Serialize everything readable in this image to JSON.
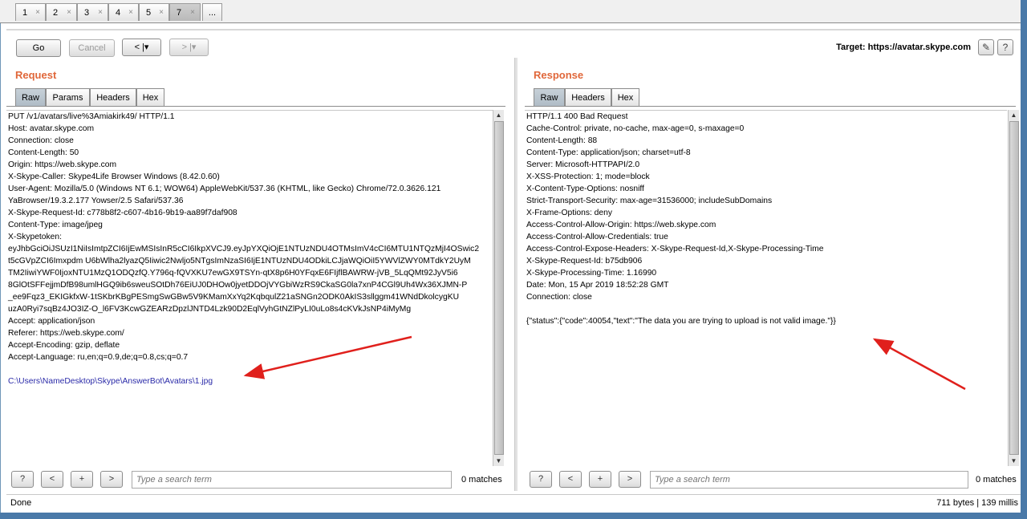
{
  "tabs": [
    {
      "label": "1",
      "close": "×"
    },
    {
      "label": "2",
      "close": "×"
    },
    {
      "label": "3",
      "close": "×"
    },
    {
      "label": "4",
      "close": "×"
    },
    {
      "label": "5",
      "close": "×"
    },
    {
      "label": "7",
      "close": "×"
    },
    {
      "label": "..."
    }
  ],
  "toolbar": {
    "go": "Go",
    "cancel": "Cancel",
    "back": "< |▾",
    "forward": "> |▾",
    "target": "Target: https://avatar.skype.com",
    "edit_icon": "✎",
    "help_icon": "?"
  },
  "request": {
    "title": "Request",
    "tabs": [
      "Raw",
      "Params",
      "Headers",
      "Hex"
    ],
    "lines": [
      "PUT /v1/avatars/live%3Amiakirk49/ HTTP/1.1",
      "Host: avatar.skype.com",
      "Connection: close",
      "Content-Length: 50",
      "Origin: https://web.skype.com",
      "X-Skype-Caller: Skype4Life Browser Windows (8.42.0.60)",
      "User-Agent: Mozilla/5.0 (Windows NT 6.1; WOW64) AppleWebKit/537.36 (KHTML, like Gecko) Chrome/72.0.3626.121",
      "YaBrowser/19.3.2.177 Yowser/2.5 Safari/537.36",
      "X-Skype-Request-Id: c778b8f2-c607-4b16-9b19-aa89f7daf908",
      "Content-Type: image/jpeg",
      "X-Skypetoken:",
      "eyJhbGciOiJSUzI1NiIsImtpZCI6IjEwMSIsInR5cCI6IkpXVCJ9.eyJpYXQiOjE1NTUzNDU4OTMsImV4cCI6MTU1NTQzMjI4OSwic2",
      "t5cGVpZCI6Imxpdm U6bWlha2lyazQ5Iiwic2Nwljo5NTgsImNzaSI6IjE1NTUzNDU4ODkiLCJjaWQiOiI5YWVlZWY0MTdkY2UyM",
      "TM2IiwiYWF0IjoxNTU1MzQ1ODQzfQ.Y796q-fQVXKU7ewGX9TSYn-qtX8p6H0YFqxE6FIjflBAWRW-jVB_5LqQMt92JyV5i6",
      "8GlOtSFFejjmDfB98umlHGQ9ib6sweuSOtDh76EiUJ0DHOw0jyetDDOjVYGbiWzRS9CkaSG0la7xnP4CGl9Uh4Wx36XJMN-P",
      "_ee9Fqz3_EKIGkfxW-1tSKbrKBgPESmgSwGBw5V9KMamXxYq2KqbqulZ21aSNGn2ODK0AkIS3sllggm41WNdDkolcygKU",
      "uzA0Ryi7sqBz4JO3IZ-O_l6FV3KcwGZEARzDpzlJNTD4Lzk90D2EqlVyhGtNZlPyLI0uLo8s4cKVkJsNP4iMyMg",
      "Accept: application/json",
      "Referer: https://web.skype.com/",
      "Accept-Encoding: gzip, deflate",
      "Accept-Language: ru,en;q=0.9,de;q=0.8,cs;q=0.7",
      "",
      "C:\\Users\\NameDesktop\\Skype\\AnswerBot\\Avatars\\1.jpg"
    ],
    "search_placeholder": "Type a search term",
    "matches": "0 matches"
  },
  "response": {
    "title": "Response",
    "tabs": [
      "Raw",
      "Headers",
      "Hex"
    ],
    "lines": [
      "HTTP/1.1 400 Bad Request",
      "Cache-Control: private, no-cache, max-age=0, s-maxage=0",
      "Content-Length: 88",
      "Content-Type: application/json; charset=utf-8",
      "Server: Microsoft-HTTPAPI/2.0",
      "X-XSS-Protection: 1; mode=block",
      "X-Content-Type-Options: nosniff",
      "Strict-Transport-Security: max-age=31536000; includeSubDomains",
      "X-Frame-Options: deny",
      "Access-Control-Allow-Origin: https://web.skype.com",
      "Access-Control-Allow-Credentials: true",
      "Access-Control-Expose-Headers: X-Skype-Request-Id,X-Skype-Processing-Time",
      "X-Skype-Request-Id: b75db906",
      "X-Skype-Processing-Time: 1.16990",
      "Date: Mon, 15 Apr 2019 18:52:28 GMT",
      "Connection: close",
      "",
      "{\"status\":{\"code\":40054,\"text\":\"The data you are trying to upload is not valid image.\"}}"
    ],
    "search_placeholder": "Type a search term",
    "matches": "0 matches"
  },
  "search_buttons": {
    "help": "?",
    "prev": "<",
    "add": "+",
    "next": ">"
  },
  "status": {
    "left": "Done",
    "right": "711 bytes | 139 millis"
  },
  "colors": {
    "accent": "#e0673a",
    "annotation_arrow": "#e0201c",
    "frame": "#4a79a8"
  }
}
